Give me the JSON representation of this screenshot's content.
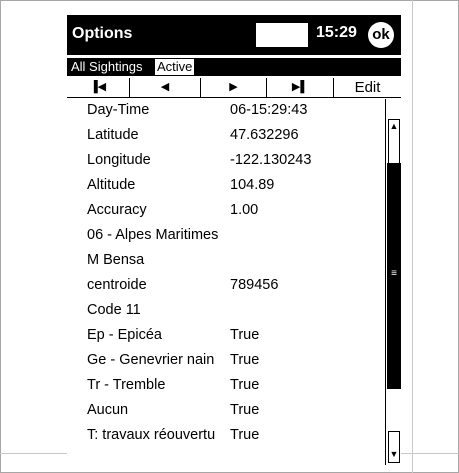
{
  "titlebar": {
    "title": "Options",
    "time": "15:29",
    "ok_label": "ok"
  },
  "tabs": [
    {
      "label": "All Sightings",
      "active": false
    },
    {
      "label": "Active",
      "active": true
    }
  ],
  "toolbar": {
    "first_icon": "skip-first-icon",
    "prev_icon": "previous-icon",
    "next_icon": "next-icon",
    "last_icon": "skip-last-icon",
    "first_glyph": "▐◀",
    "prev_glyph": "◀",
    "next_glyph": "▶",
    "last_glyph": "▶▌",
    "edit_label": "Edit"
  },
  "rows": [
    {
      "label": "Day-Time",
      "value": "06-15:29:43"
    },
    {
      "label": "Latitude",
      "value": "47.632296"
    },
    {
      "label": "Longitude",
      "value": "-122.130243"
    },
    {
      "label": "Altitude",
      "value": "104.89"
    },
    {
      "label": "Accuracy",
      "value": "1.00"
    },
    {
      "label": "06 - Alpes Maritimes",
      "value": ""
    },
    {
      "label": "M Bensa",
      "value": ""
    },
    {
      "label": "centroide",
      "value": "789456"
    },
    {
      "label": "Code 11",
      "value": ""
    },
    {
      "label": "Ep - Epicéa",
      "value": "True"
    },
    {
      "label": "Ge - Genevrier nain",
      "value": "True"
    },
    {
      "label": "Tr - Tremble",
      "value": "True"
    },
    {
      "label": "Aucun",
      "value": "True"
    },
    {
      "label": "T: travaux réouvertu",
      "value": "True"
    }
  ],
  "colors": {
    "titlebar_bg": "#000000",
    "text": "#000000",
    "background": "#ffffff"
  }
}
